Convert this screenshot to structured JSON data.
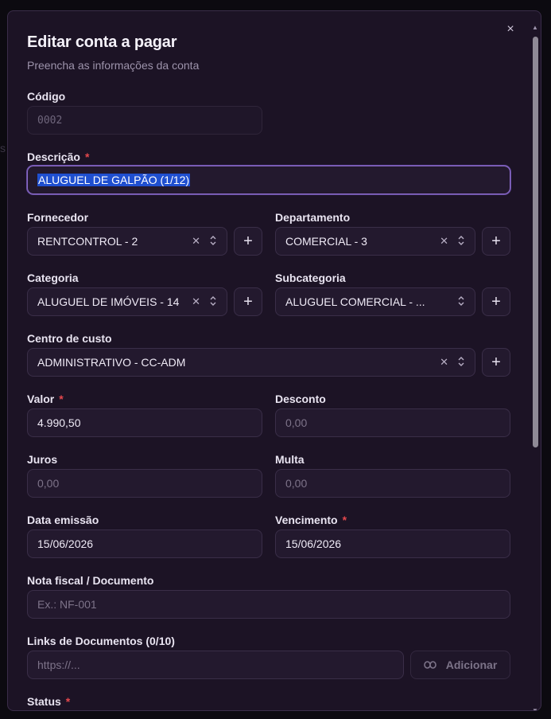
{
  "modal": {
    "title": "Editar conta a pagar",
    "subtitle": "Preencha as informações da conta",
    "close_icon": "×"
  },
  "required_mark": "*",
  "fields": {
    "codigo": {
      "label": "Código",
      "value": "0002"
    },
    "descricao": {
      "label": "Descrição",
      "value": "ALUGUEL DE GALPÃO (1/12)"
    },
    "fornecedor": {
      "label": "Fornecedor",
      "value": "RENTCONTROL - 2"
    },
    "departamento": {
      "label": "Departamento",
      "value": "COMERCIAL - 3"
    },
    "categoria": {
      "label": "Categoria",
      "value": "ALUGUEL DE IMÓVEIS - 14"
    },
    "subcategoria": {
      "label": "Subcategoria",
      "value": "ALUGUEL COMERCIAL - ..."
    },
    "centro_custo": {
      "label": "Centro de custo",
      "value": "ADMINISTRATIVO - CC-ADM"
    },
    "valor": {
      "label": "Valor",
      "value": "4.990,50"
    },
    "desconto": {
      "label": "Desconto",
      "placeholder": "0,00"
    },
    "juros": {
      "label": "Juros",
      "placeholder": "0,00"
    },
    "multa": {
      "label": "Multa",
      "placeholder": "0,00"
    },
    "data_emissao": {
      "label": "Data emissão",
      "value": "15/06/2026"
    },
    "vencimento": {
      "label": "Vencimento",
      "value": "15/06/2026"
    },
    "nota_fiscal": {
      "label": "Nota fiscal / Documento",
      "placeholder": "Ex.: NF-001"
    },
    "links": {
      "label": "Links de Documentos (0/10)",
      "placeholder": "https://...",
      "add_label": "Adicionar"
    },
    "status": {
      "label": "Status"
    }
  },
  "icons": {
    "clear": "✕",
    "chevron_updown": "⌃⌄",
    "plus": "+",
    "link": "link-icon"
  },
  "colors": {
    "modal_bg": "#1c1325",
    "field_bg": "#23192e",
    "focus_border": "#8b6cc8",
    "selection": "#1f4fd0",
    "required": "#e5484d"
  }
}
